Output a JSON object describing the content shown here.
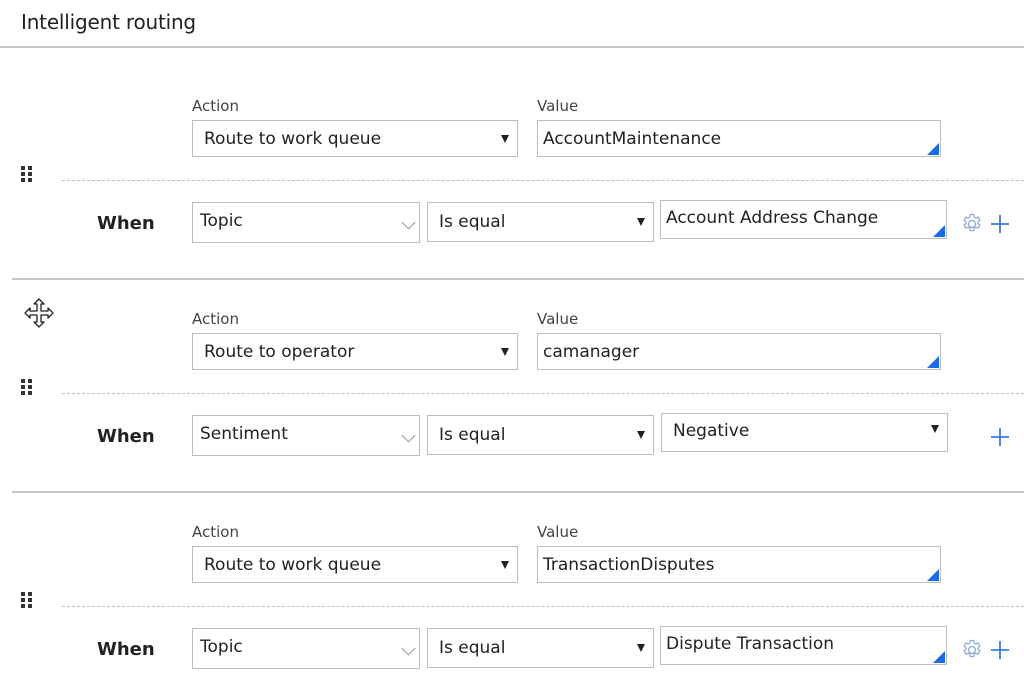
{
  "header": {
    "title": "Intelligent routing"
  },
  "labels": {
    "action": "Action",
    "value": "Value",
    "when": "When"
  },
  "colors": {
    "accent": "#1a6be8",
    "icon": "#3b7dd8"
  },
  "rules": [
    {
      "action": "Route to work queue",
      "value": "AccountMaintenance",
      "condition": {
        "field": "Topic",
        "operator": "Is equal",
        "value": "Account Address Change",
        "value_type": "autocomplete",
        "has_settings": true
      }
    },
    {
      "action": "Route to operator",
      "value": "camanager",
      "condition": {
        "field": "Sentiment",
        "operator": "Is equal",
        "value": "Negative",
        "value_type": "dropdown",
        "has_settings": false
      }
    },
    {
      "action": "Route to work queue",
      "value": "TransactionDisputes",
      "condition": {
        "field": "Topic",
        "operator": "Is equal",
        "value": "Dispute Transaction",
        "value_type": "autocomplete",
        "has_settings": true
      }
    }
  ],
  "cursor": {
    "type": "move-cursor"
  }
}
